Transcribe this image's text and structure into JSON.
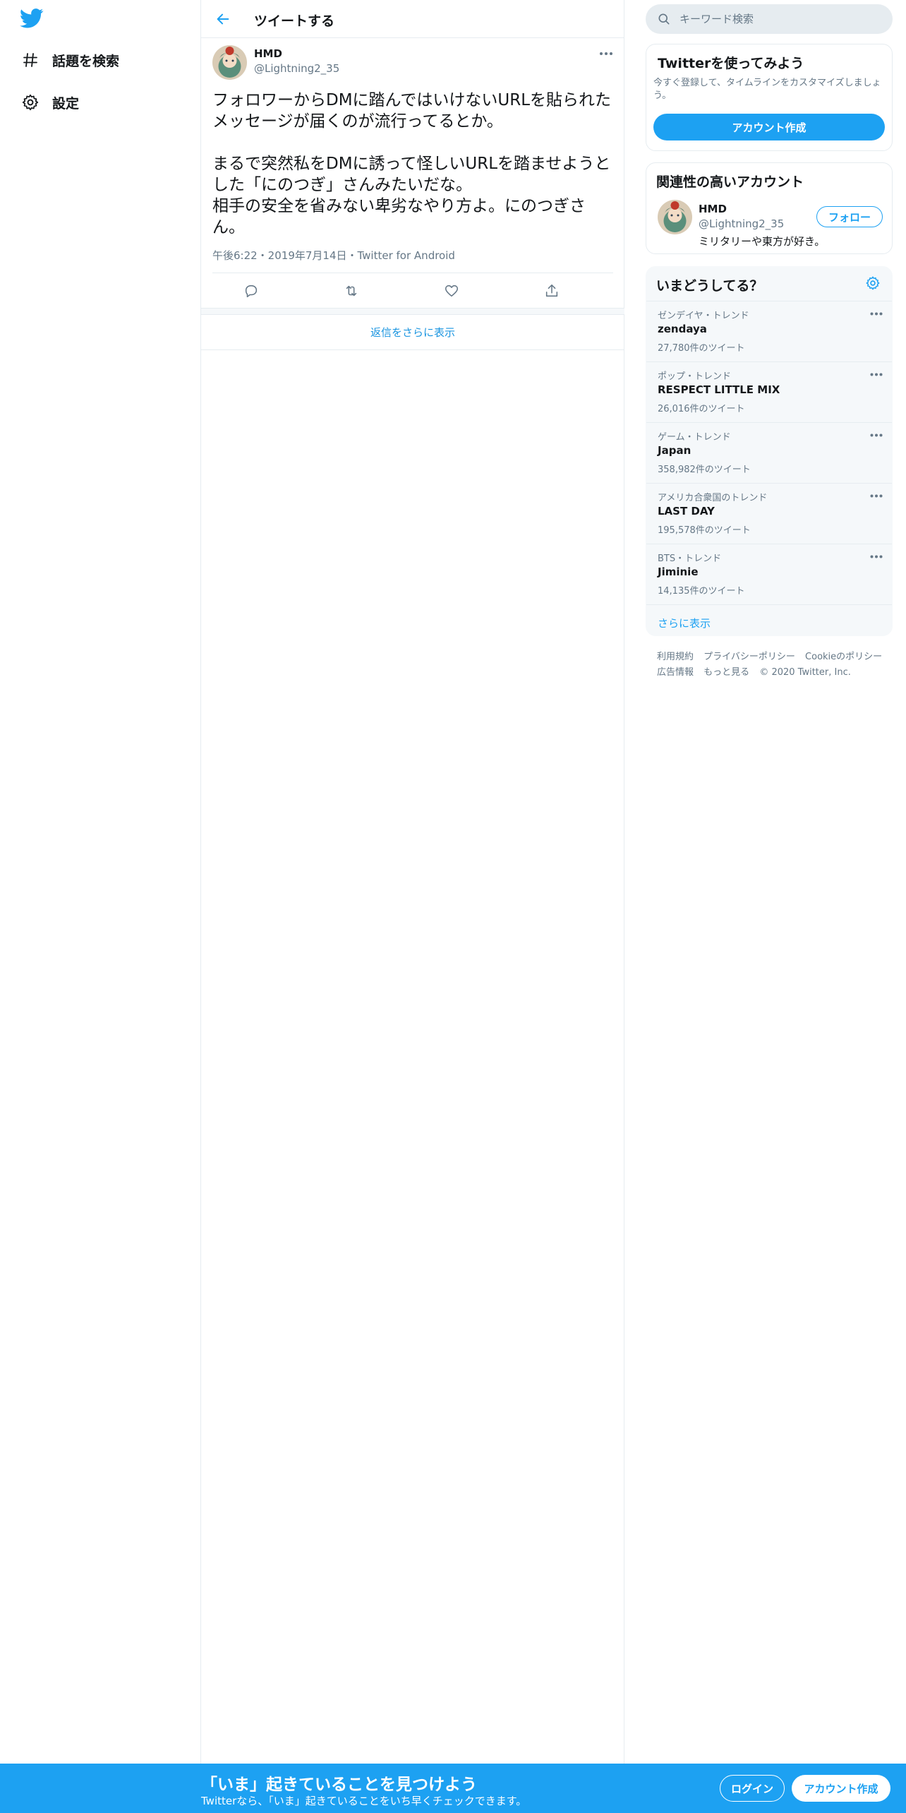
{
  "nav": {
    "logo_icon": "twitter-bird-icon",
    "items": [
      {
        "label": "話題を検索",
        "icon": "hashtag-icon"
      },
      {
        "label": "設定",
        "icon": "gear-icon"
      }
    ]
  },
  "header": {
    "title": "ツイートする",
    "back_icon": "back-arrow-icon"
  },
  "tweet": {
    "author_name": "HMD",
    "author_handle": "@Lightning2_35",
    "text": "フォロワーからDMに踏んではいけないURLを貼られたメッセージが届くのが流行ってるとか。\n\nまるで突然私をDMに誘って怪しいURLを踏ませようとした「にのつぎ」さんみたいだな。\n相手の安全を省みない卑劣なやり方よ。にのつぎさん。",
    "meta": "午後6:22・2019年7月14日・Twitter for Android",
    "actions": [
      "reply-icon",
      "retweet-icon",
      "like-icon",
      "share-icon"
    ],
    "more_replies": "返信をさらに表示"
  },
  "search": {
    "placeholder": "キーワード検索"
  },
  "signup_card": {
    "title": "Twitterを使ってみよう",
    "desc": "今すぐ登録して、タイムラインをカスタマイズしましょう。",
    "button": "アカウント作成"
  },
  "related": {
    "title": "関連性の高いアカウント",
    "name": "HMD",
    "handle": "@Lightning2_35",
    "bio": "ミリタリーや東方が好き。",
    "follow": "フォロー"
  },
  "trends": {
    "title": "いまどうしてる？",
    "items": [
      {
        "category": "ゼンデイヤ・トレンド",
        "name": "zendaya",
        "count": "27,780件のツイート"
      },
      {
        "category": "ポップ・トレンド",
        "name": "RESPECT LITTLE MIX",
        "count": "26,016件のツイート"
      },
      {
        "category": "ゲーム・トレンド",
        "name": "Japan",
        "count": "358,982件のツイート"
      },
      {
        "category": "アメリカ合衆国のトレンド",
        "name": "LAST DAY",
        "count": "195,578件のツイート"
      },
      {
        "category": "BTS・トレンド",
        "name": "Jiminie",
        "count": "14,135件のツイート"
      }
    ],
    "show_more": "さらに表示"
  },
  "footer": {
    "terms": "利用規約",
    "privacy": "プライバシーポリシー",
    "cookie": "Cookieのポリシー",
    "ads": "広告情報",
    "more": "もっと見る",
    "copyright": "© 2020 Twitter, Inc."
  },
  "bottom_bar": {
    "title": "「いま」起きていることを見つけよう",
    "subtitle": "Twitterなら、「いま」起きていることをいち早くチェックできます。",
    "login": "ログイン",
    "signup": "アカウント作成"
  },
  "colors": {
    "accent": "#1da1f2",
    "text": "#14171a",
    "muted": "#657786",
    "border": "#e6ecf0"
  }
}
